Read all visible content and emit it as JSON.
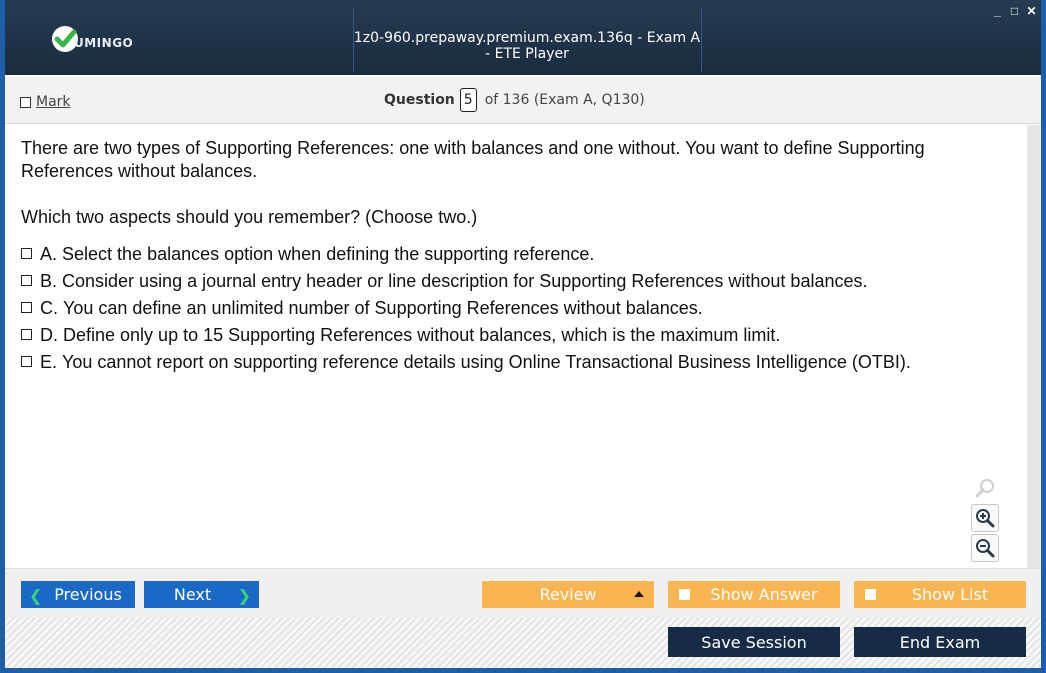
{
  "header": {
    "brand": "UMINGO",
    "title": "1z0-960.prepaway.premium.exam.136q - Exam A - ETE Player",
    "window_controls": [
      "_",
      "□",
      "✕"
    ]
  },
  "question_bar": {
    "mark_label": "Mark",
    "question_label": "Question",
    "question_number": "5",
    "question_of": "of 136 (Exam A, Q130)"
  },
  "question": {
    "paragraphs": [
      "There are two types of Supporting References: one with balances and one without. You want to define Supporting References without balances.",
      "Which two aspects should you remember? (Choose two.)"
    ],
    "options": [
      {
        "letter": "A.",
        "text": "Select the balances option when defining the supporting reference."
      },
      {
        "letter": "B.",
        "text": "Consider using a journal entry header or line description for Supporting References without balances."
      },
      {
        "letter": "C.",
        "text": "You can define an unlimited number of Supporting References without balances."
      },
      {
        "letter": "D.",
        "text": "Define only up to 15 Supporting References without balances, which is the maximum limit."
      },
      {
        "letter": "E.",
        "text": "You cannot report on supporting reference details using Online Transactional Business Intelligence (OTBI)."
      }
    ]
  },
  "zoom": {
    "icons": [
      "search-icon",
      "zoom-in-icon",
      "zoom-out-icon"
    ]
  },
  "nav": {
    "previous_label": "Previous",
    "next_label": "Next",
    "review_label": "Review",
    "show_answer_label": "Show Answer",
    "show_list_label": "Show List"
  },
  "actions": {
    "save_session_label": "Save Session",
    "end_exam_label": "End Exam"
  },
  "colors": {
    "header_bg": "#1f3247",
    "nav_blue": "#1a69c4",
    "nav_orange": "#f9b552",
    "action_dark": "#152c44",
    "logo_green": "#3cb54a"
  }
}
